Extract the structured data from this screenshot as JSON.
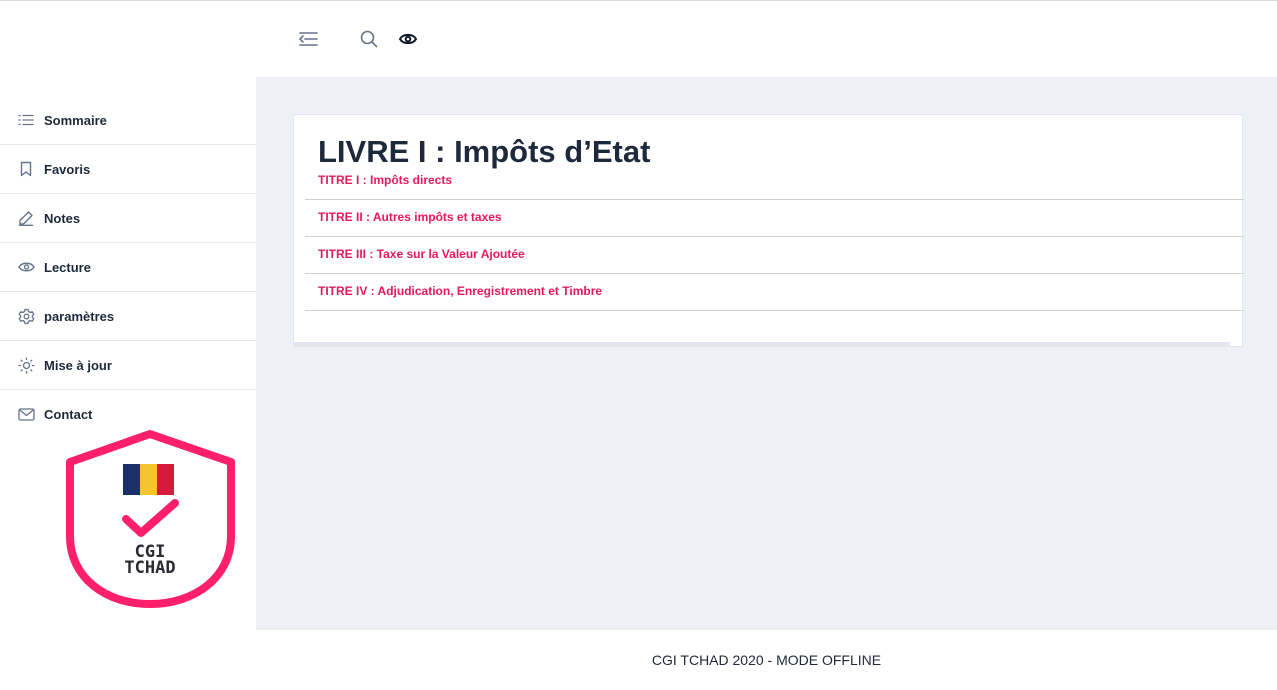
{
  "topbar": {
    "menu_icon": "menu-collapse-icon",
    "search_icon": "search-icon",
    "eye_icon": "eye-icon"
  },
  "sidebar": {
    "items": [
      {
        "label": "Sommaire",
        "icon": "list-icon"
      },
      {
        "label": "Favoris",
        "icon": "bookmark-icon"
      },
      {
        "label": "Notes",
        "icon": "pencil-icon"
      },
      {
        "label": "Lecture",
        "icon": "eye-icon"
      },
      {
        "label": "paramètres",
        "icon": "gear-icon"
      },
      {
        "label": "Mise à jour",
        "icon": "sun-icon"
      },
      {
        "label": "Contact",
        "icon": "mail-icon"
      }
    ]
  },
  "logo": {
    "line1": "CGI",
    "line2": "TCHAD",
    "flag_colors": [
      "#1c2f6b",
      "#f7c331",
      "#d61a3c"
    ],
    "accent": "#ff1f6b"
  },
  "main": {
    "title": "LIVRE I : Impôts d’Etat",
    "titres": [
      "TITRE I : Impôts directs",
      "TITRE II : Autres impôts et taxes",
      "TITRE III : Taxe sur la Valeur Ajoutée",
      "TITRE IV : Adjudication, Enregistrement et Timbre"
    ]
  },
  "footer": {
    "text": "CGI TCHAD 2020 - MODE OFFLINE"
  },
  "colors": {
    "accent": "#e5185f",
    "main_bg": "#edf0f5",
    "text": "#1e293b"
  }
}
